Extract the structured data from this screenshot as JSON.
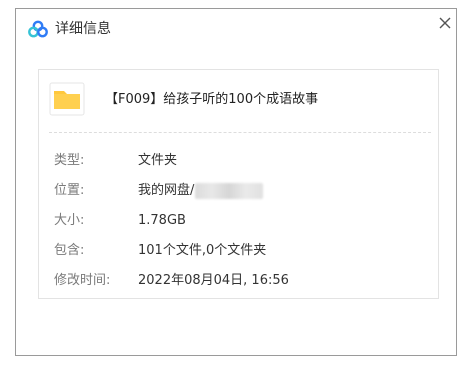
{
  "dialog": {
    "title": "详细信息",
    "logo_icon": "cloud-icon",
    "close_icon": "close-icon"
  },
  "file": {
    "icon": "folder-icon",
    "icon_color": "#FFC83D",
    "name": "【F009】给孩子听的100个成语故事"
  },
  "details": [
    {
      "label": "类型:",
      "value": "文件夹"
    },
    {
      "label": "位置:",
      "value": "我的网盘/"
    },
    {
      "label": "大小:",
      "value": "1.78GB"
    },
    {
      "label": "包含:",
      "value": "101个文件,0个文件夹"
    },
    {
      "label": "修改时间:",
      "value": "2022年08月04日, 16:56"
    }
  ],
  "colors": {
    "logo_blue": "#2F7CF6",
    "logo_teal": "#36C3D6"
  }
}
